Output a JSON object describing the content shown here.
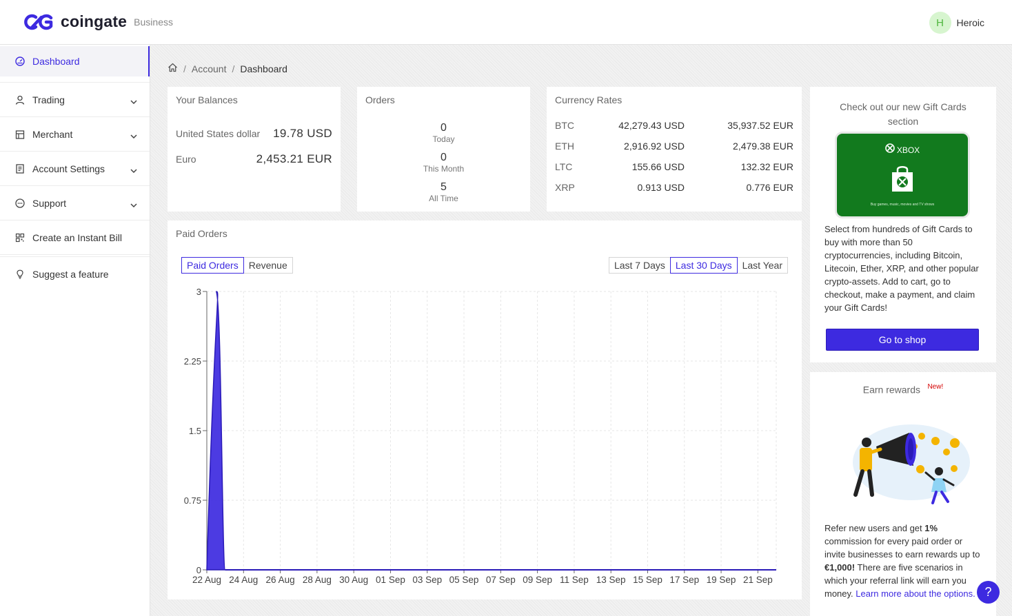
{
  "brand": {
    "name": "coingate",
    "sub": "Business"
  },
  "user": {
    "initial": "H",
    "name": "Heroic"
  },
  "sidebar": {
    "items": [
      {
        "label": "Dashboard"
      },
      {
        "label": "Trading"
      },
      {
        "label": "Merchant"
      },
      {
        "label": "Account Settings"
      },
      {
        "label": "Support"
      },
      {
        "label": "Create an Instant Bill"
      }
    ],
    "suggest": "Suggest a feature"
  },
  "breadcrumb": {
    "account": "Account",
    "current": "Dashboard"
  },
  "balances": {
    "title": "Your Balances",
    "rows": [
      {
        "label": "United States dollar",
        "value": "19.78 USD"
      },
      {
        "label": "Euro",
        "value": "2,453.21 EUR"
      }
    ]
  },
  "orders": {
    "title": "Orders",
    "stats": [
      {
        "value": "0",
        "label": "Today"
      },
      {
        "value": "0",
        "label": "This Month"
      },
      {
        "value": "5",
        "label": "All Time"
      }
    ]
  },
  "rates": {
    "title": "Currency Rates",
    "rows": [
      {
        "currency": "BTC",
        "usd": "42,279.43 USD",
        "eur": "35,937.52 EUR"
      },
      {
        "currency": "ETH",
        "usd": "2,916.92 USD",
        "eur": "2,479.38 EUR"
      },
      {
        "currency": "LTC",
        "usd": "155.66 USD",
        "eur": "132.32 EUR"
      },
      {
        "currency": "XRP",
        "usd": "0.913 USD",
        "eur": "0.776 EUR"
      }
    ]
  },
  "paid_orders": {
    "title": "Paid Orders",
    "toggle": [
      "Paid Orders",
      "Revenue"
    ],
    "ranges": [
      "Last 7 Days",
      "Last 30 Days",
      "Last Year"
    ],
    "active_range": "Last 30 Days"
  },
  "chart_data": {
    "type": "area",
    "x": [
      "22 Aug",
      "23 Aug",
      "24 Aug",
      "25 Aug",
      "26 Aug",
      "27 Aug",
      "28 Aug",
      "29 Aug",
      "30 Aug",
      "31 Aug",
      "01 Sep",
      "02 Sep",
      "03 Sep",
      "04 Sep",
      "05 Sep",
      "06 Sep",
      "07 Sep",
      "08 Sep",
      "09 Sep",
      "10 Sep",
      "11 Sep",
      "12 Sep",
      "13 Sep",
      "14 Sep",
      "15 Sep",
      "16 Sep",
      "17 Sep",
      "18 Sep",
      "19 Sep",
      "20 Sep",
      "21 Sep",
      "22 Sep"
    ],
    "tick_labels": [
      "22 Aug",
      "24 Aug",
      "26 Aug",
      "28 Aug",
      "30 Aug",
      "01 Sep",
      "03 Sep",
      "05 Sep",
      "07 Sep",
      "09 Sep",
      "11 Sep",
      "13 Sep",
      "15 Sep",
      "17 Sep",
      "19 Sep",
      "21 Sep"
    ],
    "series": [
      {
        "values": [
          3,
          0,
          0,
          0,
          0,
          0,
          0,
          0,
          0,
          0,
          0,
          0,
          0,
          0,
          0,
          0,
          0,
          0,
          0,
          0,
          0,
          0,
          0,
          0,
          0,
          0,
          0,
          0,
          0,
          0,
          0,
          0
        ]
      }
    ],
    "yticks": [
      "0",
      "0.75",
      "1.5",
      "2.25",
      "3"
    ],
    "ylim": [
      0,
      3
    ],
    "grid": true,
    "color": "#3d2ae0"
  },
  "gift": {
    "title": "Check out our new Gift Cards section",
    "card_brand": "XBOX",
    "card_caption": "Buy games, music, movies and TV shows",
    "text": "Select from hundreds of Gift Cards to buy with more than 50 cryptocurrencies, including Bitcoin, Litecoin, Ether, XRP, and other popular crypto-assets. Add to cart, go to checkout, make a payment, and claim your Gift Cards!",
    "button": "Go to shop"
  },
  "rewards": {
    "title": "Earn rewards",
    "badge": "New!",
    "text_1": "Refer new users and get ",
    "bold_1": "1%",
    "text_2": " commission for every paid order or invite businesses to earn rewards up to ",
    "bold_2": "€1,000!",
    "text_3": " There are five scenarios in which your referral link will earn you money. ",
    "link": "Learn more about the options."
  },
  "help": "?",
  "colors": {
    "accent": "#3d2ae0",
    "xbox_green": "#127a1e"
  }
}
